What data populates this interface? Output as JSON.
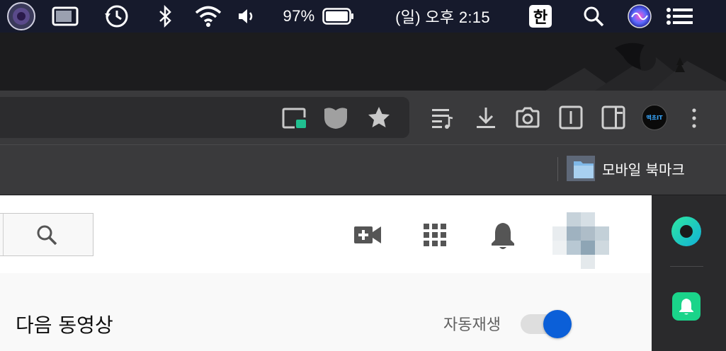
{
  "menubar": {
    "battery_percent": "97%",
    "clock": "(일) 오후 2:15",
    "input_method": "한",
    "icons": [
      "screen-recorder-icon",
      "display-icon",
      "time-machine-icon",
      "bluetooth-icon",
      "wifi-icon",
      "volume-icon",
      "battery-icon",
      "input-method-icon",
      "spotlight-icon",
      "siri-icon",
      "control-center-icon"
    ]
  },
  "toolbar": {
    "icons": [
      "picture-in-picture-icon",
      "shield-icon",
      "star-icon",
      "reading-list-icon",
      "download-icon",
      "screenshot-icon",
      "reader-mode-icon",
      "sidebar-icon",
      "profile-avatar",
      "more-menu-icon"
    ],
    "avatar_text": "맥초IT"
  },
  "bookmarks": {
    "folder_label": "모바일 북마크"
  },
  "page": {
    "next_video_heading": "다음 동영상",
    "autoplay_label": "자동재생",
    "autoplay_on": true,
    "icons": [
      "search-icon",
      "create-video-icon",
      "apps-grid-icon",
      "notifications-bell-icon",
      "account-avatar"
    ]
  },
  "sidepanel": {
    "icons": [
      "whale-app-icon",
      "alerts-app-icon"
    ]
  },
  "colors": {
    "accent_blue": "#0b5fd8",
    "sidepanel_green": "#1ad48a"
  }
}
